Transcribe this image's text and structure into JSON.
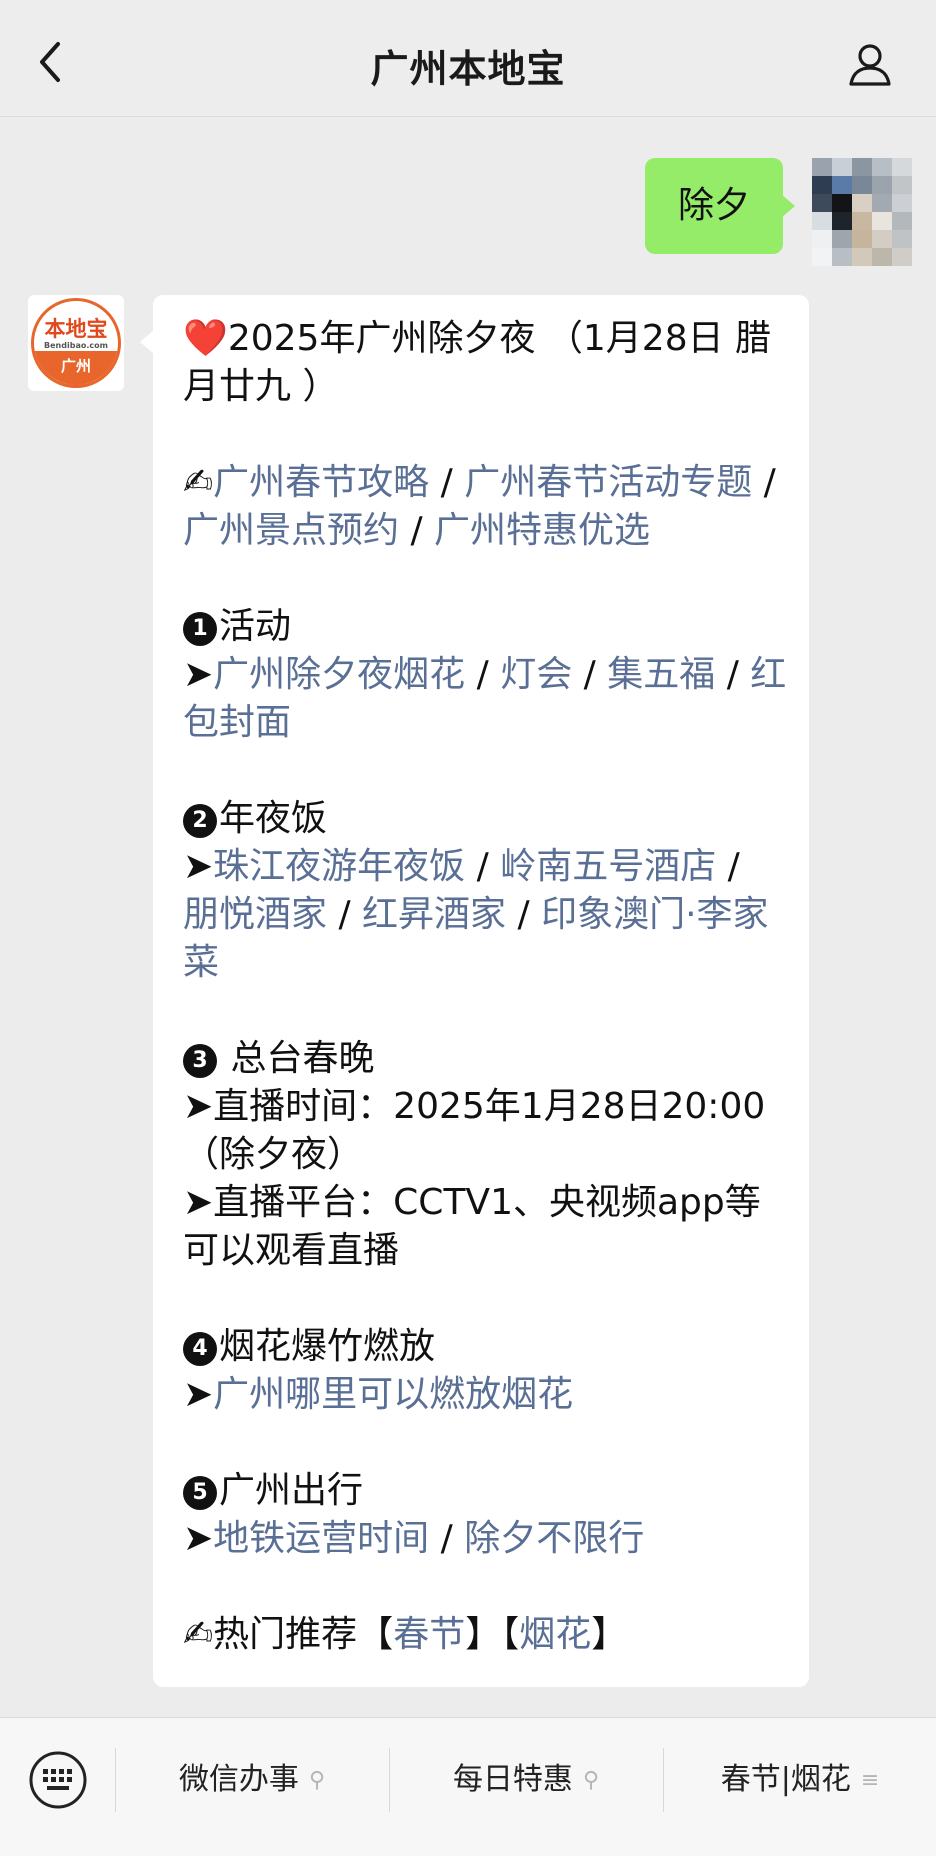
{
  "header": {
    "title": "广州本地宝",
    "back_icon": "chevron-left-icon",
    "profile_icon": "person-icon"
  },
  "outgoing_message": {
    "text": "除夕"
  },
  "brand_avatar": {
    "name": "本地宝",
    "domain": "Bendibao.com",
    "city": "广州"
  },
  "message": {
    "heading_icon": "❤️",
    "heading": "2025年广州除夕夜 （1月28日 腊月廿九 ）",
    "guide_icon": "✍",
    "guide_links": [
      "广州春节攻略",
      "广州春节活动专题",
      "广州景点预约",
      "广州特惠优选"
    ],
    "separator": " / ",
    "arrow": "➤",
    "sections": [
      {
        "number": "1",
        "title": "活动",
        "links": [
          "广州除夕夜烟花",
          "灯会",
          "集五福",
          "红包封面"
        ]
      },
      {
        "number": "2",
        "title": "年夜饭",
        "links": [
          "珠江夜游年夜饭",
          "岭南五号酒店",
          "朋悦酒家",
          "红昇酒家",
          "印象澳门·李家菜"
        ]
      },
      {
        "number": "3",
        "title": " 总台春晚",
        "lines": [
          "直播时间：2025年1月28日20:00（除夕夜）",
          "直播平台：CCTV1、央视频app等可以观看直播"
        ]
      },
      {
        "number": "4",
        "title": "烟花爆竹燃放",
        "links": [
          "广州哪里可以燃放烟花"
        ]
      },
      {
        "number": "5",
        "title": "广州出行",
        "links": [
          "地铁运营时间",
          "除夕不限行"
        ]
      }
    ],
    "hot": {
      "label": "热门推荐",
      "tags": [
        "春节",
        "烟花"
      ]
    }
  },
  "menubar": {
    "keyboard_icon": "keyboard-icon",
    "items": [
      {
        "label": "微信办事",
        "icon": "link-icon"
      },
      {
        "label": "每日特惠",
        "icon": "link-icon"
      },
      {
        "label": "春节|烟花",
        "icon": "menu-icon"
      }
    ]
  },
  "colors": {
    "link": "#5a6f95",
    "bubble_out": "#95ec69",
    "background": "#ececec",
    "brand": "#e8652b"
  }
}
